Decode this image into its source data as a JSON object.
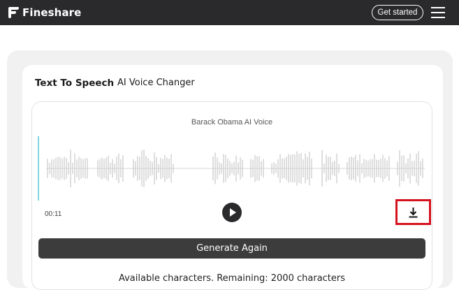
{
  "header": {
    "brand": "Fineshare",
    "get_started_label": "Get started"
  },
  "tabs": [
    {
      "label": "Text To Speech",
      "active": true
    },
    {
      "label": "AI Voice Changer",
      "active": false
    }
  ],
  "player": {
    "voice_name": "Barack Obama AI Voice",
    "time": "00:11",
    "icons": {
      "play": "play-icon",
      "download": "download-icon"
    }
  },
  "generate_label": "Generate Again",
  "available_text": "Available characters. Remaining: 2000 characters",
  "colors": {
    "topbar": "#2a2a2d",
    "highlight": "#d4121e",
    "progress": "#56c7d9",
    "wave": "#c9c9c9"
  }
}
